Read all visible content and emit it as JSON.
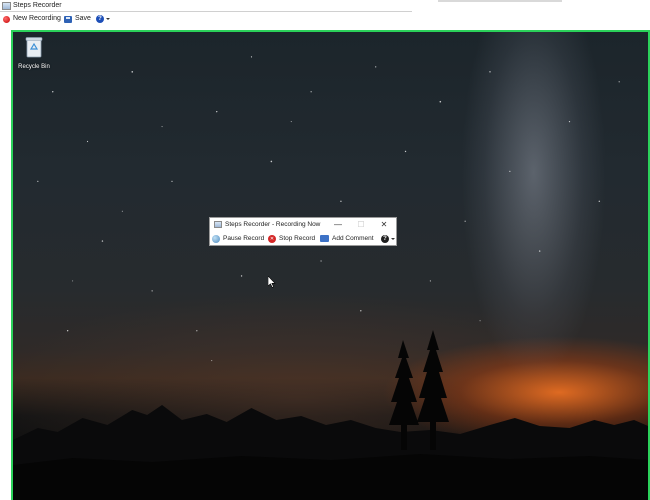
{
  "outer_window": {
    "title": "Steps Recorder",
    "toolbar": {
      "new_recording_label": "New Recording",
      "save_label": "Save"
    }
  },
  "desktop": {
    "icons": [
      {
        "label": "Recycle Bin",
        "icon": "recycle-bin-icon"
      }
    ]
  },
  "mini_window": {
    "title": "Steps Recorder - Recording Now",
    "toolbar": {
      "pause_label": "Pause Record",
      "stop_label": "Stop Record",
      "comment_label": "Add Comment"
    }
  },
  "colors": {
    "frame_border": "#2bd15a",
    "record_red": "#c40000",
    "horizon_orange": "#e86e22"
  }
}
